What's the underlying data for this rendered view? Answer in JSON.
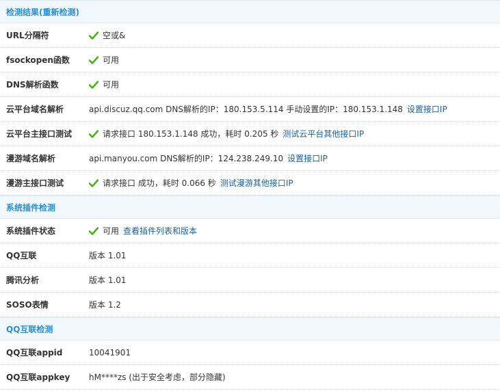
{
  "colors": {
    "section_bg": "#f0f7fd",
    "section_text": "#2b8fc9",
    "link": "#1f5e96",
    "check": "#4caf1a"
  },
  "sections": {
    "result_title": "检测结果(重新检测)",
    "plugin_title": "系统插件检测",
    "qq_title": "QQ互联检测"
  },
  "rows": {
    "url_sep": {
      "label": "URL分隔符",
      "value": "空或&"
    },
    "fsockopen": {
      "label": "fsockopen函数",
      "value": "可用"
    },
    "dns": {
      "label": "DNS解析函数",
      "value": "可用"
    },
    "cloud_domain": {
      "label": "云平台域名解析",
      "value": "api.discuz.qq.com DNS解析的IP：180.153.5.114 手动设置的IP：180.153.1.148",
      "link": "设置接口IP"
    },
    "cloud_main": {
      "label": "云平台主接口测试",
      "value": "请求接口 180.153.1.148 成功，耗时 0.205 秒",
      "link": "测试云平台其他接口IP"
    },
    "manyou_domain": {
      "label": "漫游域名解析",
      "value": "api.manyou.com DNS解析的IP：124.238.249.10",
      "link": "设置接口IP"
    },
    "manyou_main": {
      "label": "漫游主接口测试",
      "value": "请求接口 成功，耗时 0.066 秒",
      "link": "测试漫游其他接口IP"
    },
    "plugin_status": {
      "label": "系统插件状态",
      "value": "可用",
      "link": "查看插件列表和版本"
    },
    "qq_connect": {
      "label": "QQ互联",
      "value": "版本 1.01"
    },
    "tencent_analysis": {
      "label": "腾讯分析",
      "value": "版本 1.01"
    },
    "soso_emoji": {
      "label": "SOSO表情",
      "value": "版本 1.2"
    },
    "qq_appid": {
      "label": "QQ互联appid",
      "value": "10041901"
    },
    "qq_appkey": {
      "label": "QQ互联appkey",
      "value": "hM****zs (出于安全考虑，部分隐藏)"
    }
  }
}
